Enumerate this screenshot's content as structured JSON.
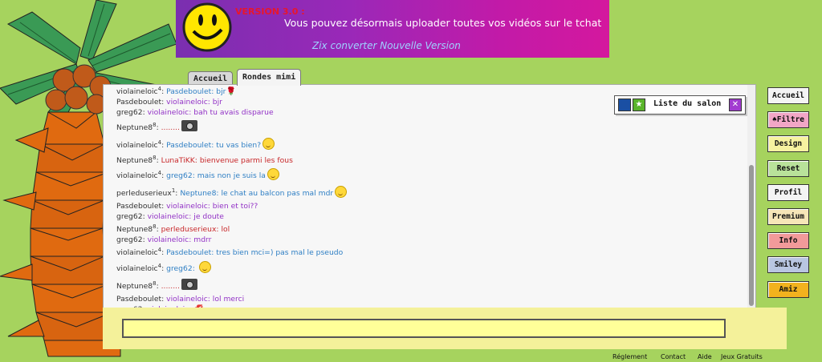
{
  "banner": {
    "version": "VERSION 3.0 :",
    "message": "Vous pouvez désormais uploader toutes vos vidéos sur le tchat",
    "link": "Zix converter Nouvelle Version"
  },
  "tabs": [
    {
      "label": "Accueil"
    },
    {
      "label": "Rondes mimi"
    }
  ],
  "salon": {
    "label": "Liste du salon"
  },
  "messages": [
    {
      "nick": "violaineloic",
      "sup": "4",
      "to": "Pasdeboulet",
      "text": "bjr",
      "extra": "rose"
    },
    {
      "nick": "Pasdeboulet",
      "sup": "",
      "to": "violaineloic",
      "text": "bjr"
    },
    {
      "nick": "greg62",
      "sup": "",
      "to": "violaineloic",
      "text": "bah tu avais disparue"
    },
    {
      "nick": "Neptune8",
      "sup": "8",
      "to": "",
      "text": "........",
      "extra": "camera"
    },
    {
      "nick": "violaineloic",
      "sup": "4",
      "to": "Pasdeboulet",
      "text": "tu vas bien?",
      "extra": "smiley"
    },
    {
      "nick": "Neptune8",
      "sup": "8",
      "to": "LunaTiKK",
      "text": "bienvenue parmi les fous"
    },
    {
      "nick": "violaineloic",
      "sup": "4",
      "to": "greg62",
      "text": "mais non je suis la",
      "extra": "smiley"
    },
    {
      "nick": "perleduserieux",
      "sup": "1",
      "to": "Neptune8",
      "text": "le chat au balcon pas mal mdr",
      "extra": "smiley"
    },
    {
      "nick": "Pasdeboulet",
      "sup": "",
      "to": "violaineloic",
      "text": "bien et toi??"
    },
    {
      "nick": "greg62",
      "sup": "",
      "to": "violaineloic",
      "text": "je doute"
    },
    {
      "nick": "Neptune8",
      "sup": "8",
      "to": "perleduserieux",
      "text": "lol"
    },
    {
      "nick": "greg62",
      "sup": "",
      "to": "violaineloic",
      "text": "mdrr"
    },
    {
      "nick": "violaineloic",
      "sup": "4",
      "to": "Pasdeboulet",
      "text": "tres bien mci=) pas mal le pseudo"
    },
    {
      "nick": "violaineloic",
      "sup": "4",
      "to": "greg62",
      "text": "",
      "extra": "smiley"
    },
    {
      "nick": "Neptune8",
      "sup": "8",
      "to": "",
      "text": "........",
      "extra": "camera"
    },
    {
      "nick": "Pasdeboulet",
      "sup": "",
      "to": "violaineloic",
      "text": "lol merci"
    },
    {
      "nick": "greg62",
      "sup": "",
      "to": "violaineloic",
      "text": "",
      "extra": "lips"
    }
  ],
  "side_buttons": [
    {
      "label": "Accueil",
      "color": "#f4f4f4"
    },
    {
      "label": "♠Filtre",
      "color": "#f2a6c6"
    },
    {
      "label": "Design",
      "color": "#f6f2a0"
    },
    {
      "label": "Reset",
      "color": "#b9e29a"
    },
    {
      "label": "Profil",
      "color": "#f4f4f4"
    },
    {
      "label": "Premium",
      "color": "#f6e6b8"
    },
    {
      "label": "Info",
      "color": "#f29a9a"
    },
    {
      "label": "Smiley",
      "color": "#b9c6e2"
    },
    {
      "label": "Amiz",
      "color": "#f2b21e"
    }
  ],
  "footer": [
    "Réglement",
    "Contact",
    "Aide",
    "Jeux Gratuits"
  ]
}
